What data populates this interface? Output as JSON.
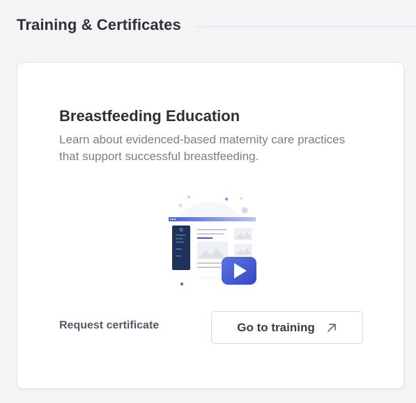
{
  "section": {
    "title": "Training & Certificates"
  },
  "card": {
    "title": "Breastfeeding Education",
    "description": "Learn about evidenced-based maternity care practices that support successful breastfeeding.",
    "illustration_icon": "video-training-illustration",
    "request_label": "Request certificate",
    "button_label": "Go to training",
    "button_icon": "external-arrow-icon"
  },
  "colors": {
    "accent": "#4a63d6",
    "text_dark": "#2e3038",
    "text_muted": "#7a7d8c",
    "background": "#f4f4f6"
  }
}
